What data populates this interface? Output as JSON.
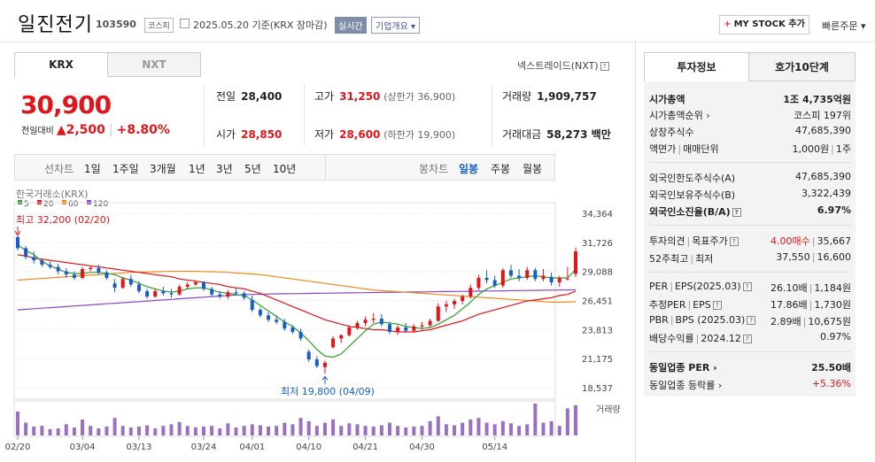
{
  "header": {
    "company": "일진전기",
    "code": "103590",
    "market": "코스피",
    "date_text": "2025.05.20  기준(KRX 장마감)",
    "realtime": "실시간",
    "overview": "기업개요 ▾",
    "mystock_plus": "+",
    "mystock": "MY STOCK 추가",
    "quick_order": "빠른주문 ▾"
  },
  "tabs": {
    "krx": "KRX",
    "nxt": "NXT",
    "nxt_link": "넥스트레이드(NXT)"
  },
  "price": {
    "current": "30,900",
    "change_label": "전일대비",
    "change": "▲2,500",
    "change_pct": "+8.80%"
  },
  "stats": {
    "prev_label": "전일",
    "prev": "28,400",
    "high_label": "고가",
    "high": "31,250",
    "upper_limit": "(상한가 36,900)",
    "volume_label": "거래량",
    "volume": "1,909,757",
    "open_label": "시가",
    "open": "28,850",
    "low_label": "저가",
    "low": "28,600",
    "lower_limit": "(하한가 19,900)",
    "amount_label": "거래대금",
    "amount": "58,273 백만"
  },
  "period_bar": {
    "line_chart": "선차트",
    "periods": [
      "1일",
      "1주일",
      "3개월",
      "1년",
      "3년",
      "5년",
      "10년"
    ],
    "candle_chart": "봉차트",
    "daily": "일봉",
    "weekly": "주봉",
    "monthly": "월봉"
  },
  "chart_data": {
    "type": "candlestick",
    "source_label": "한국거래소(KRX)",
    "legend": [
      {
        "name": "5",
        "color": "#2aa02a"
      },
      {
        "name": "20",
        "color": "#e0161b"
      },
      {
        "name": "60",
        "color": "#f08a1c"
      },
      {
        "name": "120",
        "color": "#8c46c8"
      }
    ],
    "y_ticks": [
      "34,364",
      "31,726",
      "29,088",
      "26,451",
      "23,813",
      "21,175",
      "18,537"
    ],
    "y_tick_values": [
      34364,
      31726,
      29088,
      26451,
      23813,
      21175,
      18537
    ],
    "ylim": [
      18537,
      34364
    ],
    "x_labels": [
      "02/20",
      "03/04",
      "03/13",
      "03/24",
      "04/01",
      "04/10",
      "04/21",
      "04/30",
      "05/14"
    ],
    "x_label_index": [
      0,
      8,
      15,
      23,
      29,
      36,
      43,
      50,
      59
    ],
    "max_annotation": "최고 32,200 (02/20)",
    "min_annotation": "최저 19,800 (04/09)",
    "volume_label": "거래량",
    "colors": {
      "up": "#e0161b",
      "down": "#1a5dc6"
    },
    "candles": [
      [
        32200,
        32300,
        31000,
        31200
      ],
      [
        31200,
        31400,
        30200,
        30400
      ],
      [
        30400,
        30900,
        29800,
        30100
      ],
      [
        30100,
        30300,
        29500,
        29700
      ],
      [
        29700,
        30000,
        29300,
        29500
      ],
      [
        29500,
        29800,
        28800,
        29100
      ],
      [
        29100,
        29400,
        28500,
        28800
      ],
      [
        28800,
        29100,
        28300,
        28500
      ],
      [
        28500,
        29500,
        28400,
        29300
      ],
      [
        29300,
        29600,
        29100,
        29400
      ],
      [
        29400,
        29700,
        28800,
        29000
      ],
      [
        29000,
        29200,
        28300,
        28500
      ],
      [
        28000,
        28400,
        27200,
        27600
      ],
      [
        27600,
        28600,
        27500,
        28400
      ],
      [
        28400,
        28800,
        27700,
        27900
      ],
      [
        27900,
        28200,
        27100,
        27300
      ],
      [
        27300,
        27500,
        26600,
        26800
      ],
      [
        26800,
        27500,
        26700,
        27300
      ],
      [
        27300,
        27700,
        26900,
        27100
      ],
      [
        27100,
        27500,
        26700,
        27000
      ],
      [
        27000,
        27900,
        26900,
        27700
      ],
      [
        27700,
        28100,
        27500,
        27900
      ],
      [
        27900,
        28300,
        27800,
        28100
      ],
      [
        28100,
        28200,
        27300,
        27500
      ],
      [
        27500,
        27700,
        26800,
        27000
      ],
      [
        27000,
        27300,
        26600,
        26800
      ],
      [
        26800,
        27400,
        26600,
        27200
      ],
      [
        27200,
        27600,
        26900,
        27100
      ],
      [
        27100,
        27300,
        26500,
        26700
      ],
      [
        26500,
        26900,
        25400,
        25600
      ],
      [
        25600,
        25800,
        24900,
        25100
      ],
      [
        25100,
        25400,
        24500,
        24700
      ],
      [
        24700,
        25100,
        24300,
        24500
      ],
      [
        24500,
        24800,
        23700,
        23900
      ],
      [
        24000,
        24200,
        23400,
        23600
      ],
      [
        23600,
        23900,
        22800,
        23000
      ],
      [
        21800,
        22000,
        20900,
        21100
      ],
      [
        21100,
        21400,
        20300,
        20500
      ],
      [
        20400,
        21000,
        19800,
        20800
      ],
      [
        22200,
        23200,
        22100,
        23000
      ],
      [
        23000,
        23400,
        22600,
        23300
      ],
      [
        23300,
        24200,
        23200,
        24000
      ],
      [
        24000,
        24600,
        23800,
        24400
      ],
      [
        24400,
        25000,
        24100,
        24700
      ],
      [
        24700,
        25300,
        24400,
        24800
      ],
      [
        24800,
        25200,
        24100,
        24300
      ],
      [
        24300,
        24500,
        23400,
        23600
      ],
      [
        23600,
        24200,
        23300,
        24000
      ],
      [
        24000,
        24400,
        23500,
        23700
      ],
      [
        23700,
        24300,
        23500,
        24100
      ],
      [
        24100,
        24500,
        23800,
        24200
      ],
      [
        24200,
        24800,
        24000,
        24600
      ],
      [
        24600,
        26200,
        24500,
        25900
      ],
      [
        25900,
        26400,
        25400,
        26100
      ],
      [
        26100,
        26600,
        25700,
        26400
      ],
      [
        26400,
        27000,
        26100,
        26800
      ],
      [
        26800,
        27900,
        26600,
        27600
      ],
      [
        27600,
        28800,
        27400,
        28500
      ],
      [
        28500,
        29200,
        28000,
        28300
      ],
      [
        28300,
        28700,
        27600,
        27800
      ],
      [
        27800,
        29400,
        27600,
        29200
      ],
      [
        29200,
        29700,
        28500,
        28700
      ],
      [
        28700,
        29300,
        28200,
        28500
      ],
      [
        28500,
        29500,
        28300,
        29200
      ],
      [
        29200,
        29400,
        28200,
        28400
      ],
      [
        28400,
        29300,
        28200,
        28700
      ],
      [
        28600,
        29000,
        27800,
        28100
      ],
      [
        28100,
        28700,
        27700,
        28500
      ],
      [
        28400,
        29500,
        28300,
        28400
      ],
      [
        28850,
        31250,
        28600,
        30900
      ]
    ],
    "ma5": [
      31500,
      31000,
      30600,
      30000,
      29600,
      29300,
      29000,
      28900,
      28900,
      29000,
      29000,
      28900,
      28800,
      28500,
      28300,
      28000,
      27700,
      27500,
      27300,
      27200,
      27300,
      27500,
      27600,
      27600,
      27400,
      27200,
      27100,
      27000,
      26900,
      26500,
      26000,
      25500,
      25000,
      24500,
      24100,
      23500,
      22800,
      22000,
      21400,
      21300,
      21600,
      22300,
      23000,
      23700,
      24300,
      24500,
      24400,
      24300,
      24100,
      24000,
      23900,
      24000,
      24300,
      24700,
      25100,
      25700,
      26300,
      27000,
      27500,
      27800,
      28100,
      28400,
      28500,
      28600,
      28700,
      28600,
      28500,
      28500,
      28500,
      29300
    ],
    "ma20": [
      30600,
      30500,
      30300,
      30200,
      30100,
      30000,
      29900,
      29800,
      29700,
      29600,
      29500,
      29400,
      29300,
      29200,
      29100,
      29000,
      28900,
      28800,
      28700,
      28600,
      28400,
      28300,
      28200,
      28100,
      28000,
      27900,
      27700,
      27600,
      27500,
      27300,
      27100,
      26800,
      26500,
      26200,
      25900,
      25600,
      25300,
      25000,
      24700,
      24500,
      24300,
      24100,
      24000,
      23900,
      23800,
      23800,
      23700,
      23600,
      23600,
      23600,
      23700,
      23800,
      24000,
      24200,
      24400,
      24600,
      24900,
      25200,
      25400,
      25600,
      25800,
      26000,
      26200,
      26400,
      26500,
      26600,
      26700,
      26900,
      27000,
      27300
    ],
    "ma60": [
      28300,
      28350,
      28400,
      28450,
      28500,
      28550,
      28600,
      28650,
      28700,
      28750,
      28800,
      28850,
      28900,
      28950,
      29000,
      29020,
      29040,
      29060,
      29080,
      29100,
      29100,
      29100,
      29100,
      29080,
      29060,
      29040,
      29000,
      28950,
      28900,
      28850,
      28800,
      28700,
      28600,
      28500,
      28400,
      28300,
      28200,
      28100,
      28000,
      27900,
      27800,
      27700,
      27600,
      27500,
      27400,
      27350,
      27300,
      27250,
      27200,
      27150,
      27100,
      27050,
      27000,
      26950,
      26900,
      26850,
      26800,
      26750,
      26700,
      26650,
      26600,
      26550,
      26500,
      26450,
      26400,
      26350,
      26300,
      26300,
      26300,
      26350
    ],
    "ma120": [
      25600,
      25650,
      25700,
      25750,
      25800,
      25850,
      25900,
      25950,
      26000,
      26050,
      26100,
      26150,
      26200,
      26250,
      26300,
      26350,
      26400,
      26450,
      26500,
      26550,
      26600,
      26650,
      26700,
      26750,
      26800,
      26850,
      26900,
      26950,
      26980,
      27000,
      27020,
      27040,
      27050,
      27060,
      27070,
      27080,
      27090,
      27100,
      27110,
      27120,
      27130,
      27140,
      27150,
      27160,
      27170,
      27180,
      27190,
      27200,
      27210,
      27220,
      27230,
      27240,
      27250,
      27260,
      27270,
      27280,
      27290,
      27300,
      27310,
      27320,
      27330,
      27340,
      27350,
      27360,
      27370,
      27380,
      27390,
      27400,
      27410,
      27430
    ],
    "volume": [
      0.75,
      0.4,
      0.28,
      0.3,
      0.2,
      0.22,
      0.35,
      0.25,
      0.5,
      0.3,
      0.22,
      0.28,
      0.55,
      0.3,
      0.25,
      0.28,
      0.32,
      0.22,
      0.3,
      0.35,
      0.42,
      0.3,
      0.25,
      0.28,
      0.3,
      0.22,
      0.38,
      0.25,
      0.3,
      0.35,
      0.32,
      0.28,
      0.3,
      0.4,
      0.35,
      0.55,
      0.45,
      0.3,
      0.4,
      0.5,
      0.3,
      0.38,
      0.35,
      0.3,
      0.28,
      0.32,
      0.4,
      0.3,
      0.25,
      0.28,
      0.3,
      0.45,
      0.6,
      0.35,
      0.32,
      0.4,
      0.5,
      0.55,
      0.4,
      0.35,
      0.45,
      0.38,
      0.3,
      0.35,
      1.0,
      0.4,
      0.45,
      0.3,
      0.85,
      0.95
    ]
  },
  "side": {
    "tab_invest": "투자정보",
    "tab_hoga": "호가10단계",
    "rows": [
      {
        "l": "시가총액",
        "r": "1조 4,735억원"
      },
      {
        "l": "시가총액순위 ›",
        "r": "코스피 197위"
      },
      {
        "l": "상장주식수",
        "r": "47,685,390"
      },
      {
        "l": "액면가",
        "l2": "매매단위",
        "r": "1,000원",
        "r2": "1주"
      },
      {
        "l": "외국인한도주식수(A)",
        "r": "47,685,390"
      },
      {
        "l": "외국인보유주식수(B)",
        "r": "3,322,439"
      },
      {
        "l": "외국인소진율(B/A)",
        "r": "6.97%"
      },
      {
        "l": "투자의견",
        "l2": "목표주가",
        "r": "4.00매수",
        "r2": "35,667"
      },
      {
        "l": "52주최고",
        "l2": "최저",
        "r": "37,550",
        "r2": "16,600"
      },
      {
        "l": "PER",
        "l2": "EPS(2025.03)",
        "r": "26.10배",
        "r2": "1,184원"
      },
      {
        "l": "추정PER",
        "l2": "EPS",
        "r": "17.86배",
        "r2": "1,730원"
      },
      {
        "l": "PBR",
        "l2": "BPS (2025.03)",
        "r": "2.89배",
        "r2": "10,675원"
      },
      {
        "l": "배당수익률",
        "l2": "2024.12",
        "r": "0.97%"
      },
      {
        "l": "동일업종 PER ›",
        "r": "25.50배"
      },
      {
        "l": "동일업종 등락률 ›",
        "r": "+5.36%"
      }
    ]
  }
}
